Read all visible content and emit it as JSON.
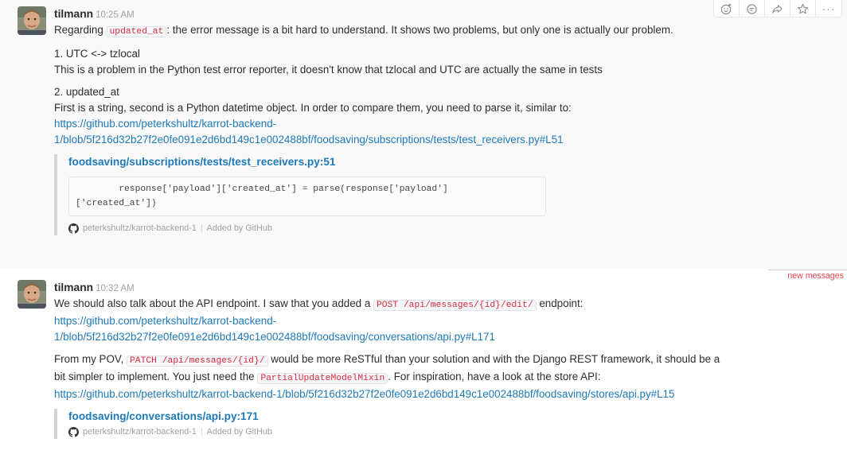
{
  "colors": {
    "link": "#1e79b8",
    "inline_code": "#d72b3f",
    "new_messages": "#e8464f",
    "attachment_bar": "#d4d4d8"
  },
  "message_actions": [
    {
      "icon": "add-reaction-icon"
    },
    {
      "icon": "comment-icon"
    },
    {
      "icon": "share-icon"
    },
    {
      "icon": "star-icon"
    },
    {
      "icon": "more-icon"
    }
  ],
  "new_messages_label": "new messages",
  "messages": [
    {
      "author": "tilmann",
      "time": "10:25 AM",
      "intro_pre": "Regarding ",
      "intro_code": "updated_at",
      "intro_post": ": the error message is a bit hard to understand. It shows two problems, but only one is actually our problem.",
      "point1_title": "1. UTC <-> tzlocal",
      "point1_body": "This is a problem in the Python test error reporter, it doesn't know that tzlocal and UTC are actually the same in tests",
      "point2_title": "2. updated_at",
      "point2_body": "First is a string, second is a Python datetime object. In order to compare them, you need to parse it, similar to:",
      "link_line1": "https://github.com/peterkshultz/karrot-backend-",
      "link_line2": "1/blob/5f216d32b27f2e0fe091e2d6bd149c1e002488bf/foodsaving/subscriptions/tests/test_receivers.py#L51",
      "attachment": {
        "title": "foodsaving/subscriptions/tests/test_receivers.py:51",
        "code": "        response['payload']['created_at'] = parse(response['payload']\n['created_at'])",
        "repo": "peterkshultz/karrot-backend-1",
        "added_by": "Added by GitHub"
      }
    },
    {
      "author": "tilmann",
      "time": "10:32 AM",
      "p1_pre": "We should also talk about the API endpoint. I saw that you added a ",
      "p1_code": "POST /api/messages/{id}/edit/",
      "p1_post": " endpoint:",
      "link1_line1": "https://github.com/peterkshultz/karrot-backend-",
      "link1_line2": "1/blob/5f216d32b27f2e0fe091e2d6bd149c1e002488bf/foodsaving/conversations/api.py#L171",
      "p2_pre": "From my POV, ",
      "p2_code": "PATCH /api/messages/{id}/",
      "p2_mid": " would be more ReSTful than your solution and with the Django REST framework, it should be a",
      "p2_line2_pre": "bit simpler to implement. You just need the ",
      "p2_code2": "PartialUpdateModelMixin",
      "p2_line2_post": ". For inspiration, have a look at the store API:",
      "link2": "https://github.com/peterkshultz/karrot-backend-1/blob/5f216d32b27f2e0fe091e2d6bd149c1e002488bf/foodsaving/stores/api.py#L15",
      "attachment": {
        "title": "foodsaving/conversations/api.py:171",
        "repo": "peterkshultz/karrot-backend-1",
        "added_by": "Added by GitHub"
      }
    }
  ]
}
